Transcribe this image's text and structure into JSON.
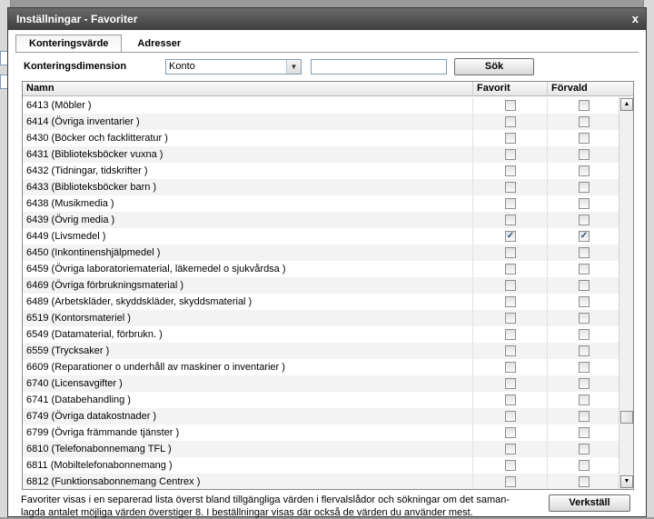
{
  "window": {
    "title": "Inställningar - Favoriter",
    "close_label": "x"
  },
  "tabs": [
    {
      "label": "Konteringsvärde",
      "active": true
    },
    {
      "label": "Adresser",
      "active": false
    }
  ],
  "filter": {
    "label": "Konteringsdimension",
    "selected": "Konto",
    "search_value": "",
    "search_button": "Sök"
  },
  "grid": {
    "columns": {
      "name": "Namn",
      "favorite": "Favorit",
      "default": "Förvald"
    },
    "rows": [
      {
        "name": "6413 (Möbler )",
        "favorite": false,
        "default": false
      },
      {
        "name": "6414 (Övriga inventarier )",
        "favorite": false,
        "default": false
      },
      {
        "name": "6430 (Böcker och facklitteratur )",
        "favorite": false,
        "default": false
      },
      {
        "name": "6431 (Biblioteksböcker vuxna )",
        "favorite": false,
        "default": false
      },
      {
        "name": "6432 (Tidningar, tidskrifter )",
        "favorite": false,
        "default": false
      },
      {
        "name": "6433 (Biblioteksböcker barn )",
        "favorite": false,
        "default": false
      },
      {
        "name": "6438 (Musikmedia )",
        "favorite": false,
        "default": false
      },
      {
        "name": "6439 (Övrig media )",
        "favorite": false,
        "default": false
      },
      {
        "name": "6449 (Livsmedel )",
        "favorite": true,
        "default": true
      },
      {
        "name": "6450 (Inkontinenshjälpmedel )",
        "favorite": false,
        "default": false
      },
      {
        "name": "6459 (Övriga laboratoriematerial, läkemedel o sjukvårdsa )",
        "favorite": false,
        "default": false
      },
      {
        "name": "6469 (Övriga förbrukningsmaterial )",
        "favorite": false,
        "default": false
      },
      {
        "name": "6489 (Arbetskläder, skyddskläder, skyddsmaterial )",
        "favorite": false,
        "default": false
      },
      {
        "name": "6519 (Kontorsmateriel )",
        "favorite": false,
        "default": false
      },
      {
        "name": "6549 (Datamaterial, förbrukn. )",
        "favorite": false,
        "default": false
      },
      {
        "name": "6559 (Trycksaker )",
        "favorite": false,
        "default": false
      },
      {
        "name": "6609 (Reparationer o underhåll av maskiner o inventarier )",
        "favorite": false,
        "default": false
      },
      {
        "name": "6740 (Licensavgifter )",
        "favorite": false,
        "default": false
      },
      {
        "name": "6741 (Databehandling )",
        "favorite": false,
        "default": false
      },
      {
        "name": "6749 (Övriga datakostnader )",
        "favorite": false,
        "default": false
      },
      {
        "name": "6799 (Övriga främmande tjänster )",
        "favorite": false,
        "default": false
      },
      {
        "name": "6810 (Telefonabonnemang TFL )",
        "favorite": false,
        "default": false
      },
      {
        "name": "6811 (Mobiltelefonabonnemang )",
        "favorite": false,
        "default": false
      },
      {
        "name": "6812 (Funktionsabonnemang Centrex )",
        "favorite": false,
        "default": false
      }
    ]
  },
  "footer": {
    "note_line1": "Favoriter visas i en separerad lista överst bland tillgängliga värden i flervalslådor och sökningar om det saman-",
    "note_line2": "lagda antalet möjliga värden överstiger 8. I beställningar visas där också de värden du använder mest.",
    "apply_button": "Verkställ"
  },
  "icons": {
    "check": "check-icon",
    "dropdown": "chevron-down-icon",
    "scroll_up": "arrow-up-icon",
    "scroll_down": "arrow-down-icon"
  }
}
